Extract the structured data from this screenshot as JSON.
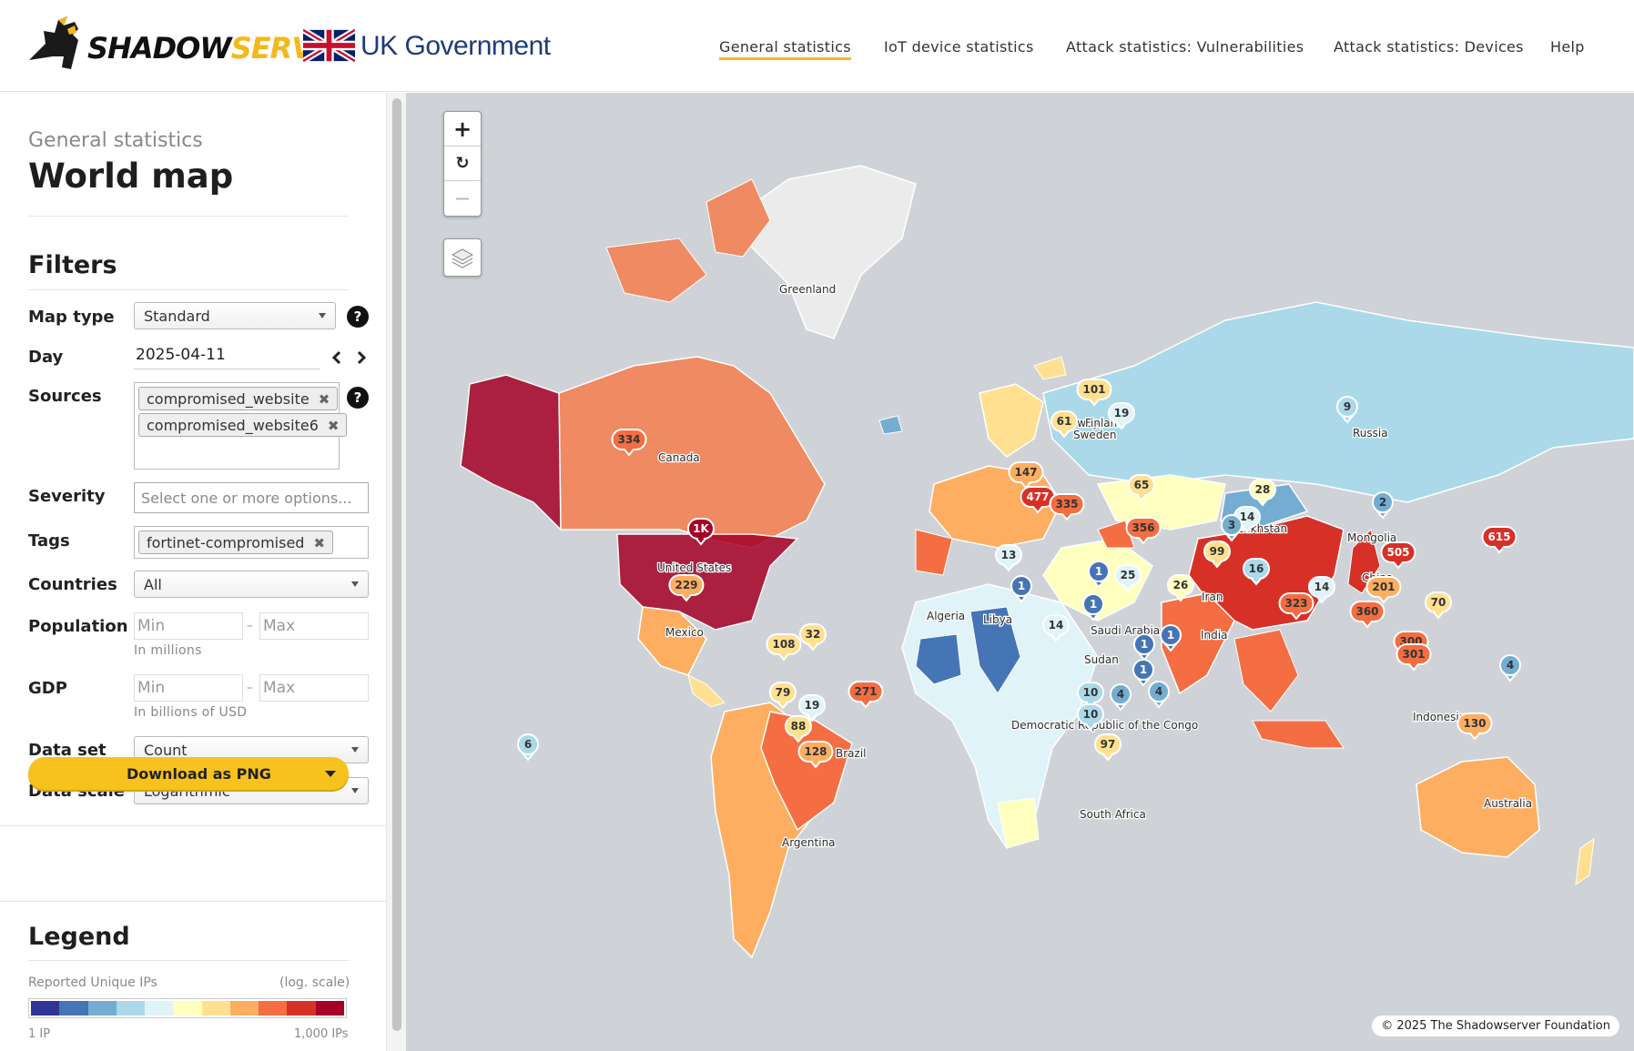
{
  "header": {
    "brand": {
      "part1": "SHADOW",
      "part2": "SERVER"
    },
    "partner": "UK Government",
    "nav": [
      {
        "label": "General statistics",
        "active": true
      },
      {
        "label": "IoT device statistics",
        "active": false
      },
      {
        "label": "Attack statistics: Vulnerabilities",
        "active": false
      },
      {
        "label": "Attack statistics: Devices",
        "active": false
      },
      {
        "label": "Help",
        "active": false
      }
    ]
  },
  "sidebar": {
    "breadcrumb": "General statistics",
    "title": "World map",
    "filters_title": "Filters",
    "filters": {
      "map_type": {
        "label": "Map type",
        "value": "Standard"
      },
      "day": {
        "label": "Day",
        "value": "2025-04-11"
      },
      "sources": {
        "label": "Sources",
        "tags": [
          "compromised_website",
          "compromised_website6"
        ]
      },
      "severity": {
        "label": "Severity",
        "placeholder": "Select one or more options..."
      },
      "tags": {
        "label": "Tags",
        "tags": [
          "fortinet-compromised"
        ]
      },
      "countries": {
        "label": "Countries",
        "value": "All"
      },
      "population": {
        "label": "Population",
        "min_placeholder": "Min",
        "max_placeholder": "Max",
        "hint": "In millions"
      },
      "gdp": {
        "label": "GDP",
        "min_placeholder": "Min",
        "max_placeholder": "Max",
        "hint": "In billions of USD"
      },
      "data_set": {
        "label": "Data set",
        "value": "Count"
      },
      "data_scale": {
        "label": "Data scale",
        "value": "Logarithmic"
      }
    },
    "help_glyph": "?",
    "download_label": "Download as PNG",
    "legend": {
      "title": "Legend",
      "subtitle": "Reported Unique IPs",
      "scale_note": "(log. scale)",
      "min_label": "1 IP",
      "max_label": "1,000 IPs",
      "colors": [
        "#313695",
        "#4575b4",
        "#74add1",
        "#abd9e9",
        "#e0f3f8",
        "#ffffbf",
        "#fee090",
        "#fdae61",
        "#f46d43",
        "#d73027",
        "#a50026"
      ]
    }
  },
  "map": {
    "zoom_in": "+",
    "zoom_reset": "↻",
    "zoom_out": "—",
    "copyright": "© 2025 The Shadowserver Foundation",
    "country_labels": [
      "Greenland",
      "Canada",
      "Russia",
      "United States",
      "Mexico",
      "Kazakhstan",
      "Mongolia",
      "China",
      "Iran",
      "Algeria",
      "Libya",
      "Saudi Arabia",
      "Sudan",
      "India",
      "Democratic Republic of the Congo",
      "Brazil",
      "Indonesia",
      "Australia",
      "South Africa",
      "Argentina",
      "Norway",
      "Finland",
      "Sweden"
    ],
    "markers": [
      {
        "value": "334",
        "color": "#f46d43"
      },
      {
        "value": "1K",
        "color": "#a50026"
      },
      {
        "value": "229",
        "color": "#fdae61"
      },
      {
        "value": "108",
        "color": "#fee090"
      },
      {
        "value": "32",
        "color": "#fee090"
      },
      {
        "value": "79",
        "color": "#fee090"
      },
      {
        "value": "19",
        "color": "#e0f3f8"
      },
      {
        "value": "271",
        "color": "#f46d43"
      },
      {
        "value": "88",
        "color": "#fee090"
      },
      {
        "value": "128",
        "color": "#fdae61"
      },
      {
        "value": "6",
        "color": "#abd9e9"
      },
      {
        "value": "101",
        "color": "#fee090"
      },
      {
        "value": "61",
        "color": "#fee090"
      },
      {
        "value": "19",
        "color": "#e0f3f8"
      },
      {
        "value": "9",
        "color": "#abd9e9"
      },
      {
        "value": "147",
        "color": "#fdae61"
      },
      {
        "value": "477",
        "color": "#d73027"
      },
      {
        "value": "335",
        "color": "#f46d43"
      },
      {
        "value": "65",
        "color": "#fee090"
      },
      {
        "value": "356",
        "color": "#f46d43"
      },
      {
        "value": "28",
        "color": "#ffffbf"
      },
      {
        "value": "14",
        "color": "#e0f3f8"
      },
      {
        "value": "3",
        "color": "#74add1"
      },
      {
        "value": "2",
        "color": "#74add1"
      },
      {
        "value": "99",
        "color": "#fee090"
      },
      {
        "value": "16",
        "color": "#abd9e9"
      },
      {
        "value": "505",
        "color": "#d73027"
      },
      {
        "value": "615",
        "color": "#d73027"
      },
      {
        "value": "13",
        "color": "#e0f3f8"
      },
      {
        "value": "1",
        "color": "#4575b4"
      },
      {
        "value": "25",
        "color": "#e0f3f8"
      },
      {
        "value": "1",
        "color": "#4575b4"
      },
      {
        "value": "26",
        "color": "#ffffbf"
      },
      {
        "value": "1",
        "color": "#4575b4"
      },
      {
        "value": "14",
        "color": "#e0f3f8"
      },
      {
        "value": "1",
        "color": "#4575b4"
      },
      {
        "value": "323",
        "color": "#f46d43"
      },
      {
        "value": "14",
        "color": "#e0f3f8"
      },
      {
        "value": "201",
        "color": "#fdae61"
      },
      {
        "value": "360",
        "color": "#f46d43"
      },
      {
        "value": "70",
        "color": "#fee090"
      },
      {
        "value": "1",
        "color": "#4575b4"
      },
      {
        "value": "1",
        "color": "#4575b4"
      },
      {
        "value": "10",
        "color": "#abd9e9"
      },
      {
        "value": "4",
        "color": "#74add1"
      },
      {
        "value": "4",
        "color": "#74add1"
      },
      {
        "value": "10",
        "color": "#abd9e9"
      },
      {
        "value": "97",
        "color": "#fee090"
      },
      {
        "value": "300",
        "color": "#f46d43"
      },
      {
        "value": "301",
        "color": "#f46d43"
      },
      {
        "value": "4",
        "color": "#74add1"
      },
      {
        "value": "130",
        "color": "#fdae61"
      }
    ]
  }
}
